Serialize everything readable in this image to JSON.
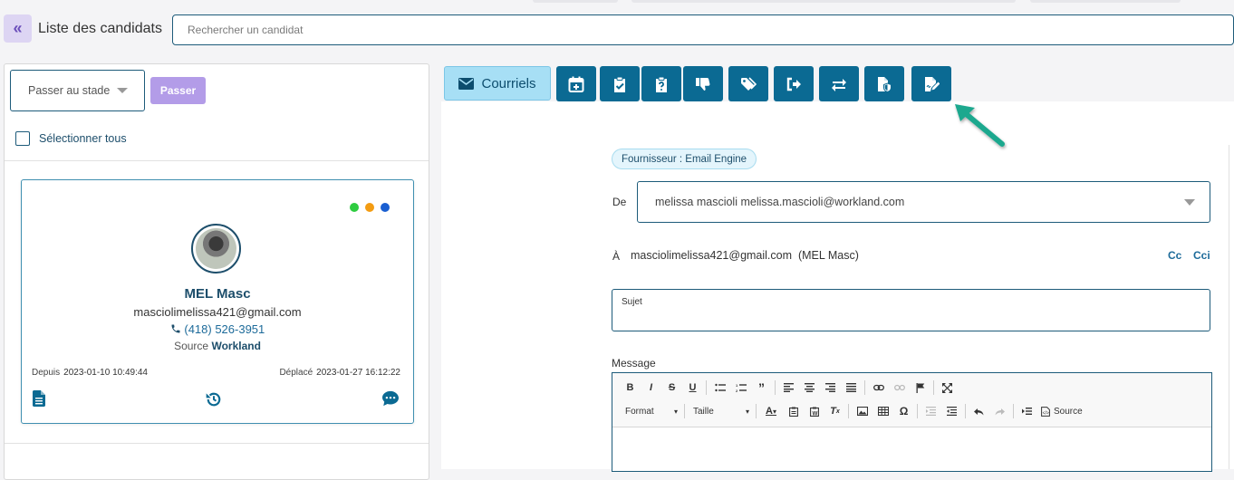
{
  "header": {
    "collapse_icon": "double-chevron-left-icon",
    "title": "Liste des candidats",
    "search_placeholder": "Rechercher un candidat"
  },
  "left_panel": {
    "stage_select": "Passer au stade",
    "pass_button": "Passer",
    "select_all": "Sélectionner tous",
    "card": {
      "status_dots": [
        "#2ecc40",
        "#f39c12",
        "#1a5fd1"
      ],
      "name": "MEL Masc",
      "email": "masciolimelissa421@gmail.com",
      "phone": "(418) 526-3951",
      "source_label": "Source",
      "source_value": "Workland",
      "since_label": "Depuis",
      "since_value": "2023-01-10 10:49:44",
      "moved_label": "Déplacé",
      "moved_value": "2023-01-27 16:12:22",
      "icons": [
        "document-icon",
        "history-icon",
        "chat-icon"
      ]
    }
  },
  "toolbar": {
    "mail_label": "Courriels",
    "buttons": [
      "calendar-add-icon",
      "clipboard-check-icon",
      "clipboard-question-icon",
      "thumbs-down-icon",
      "tags-icon",
      "sign-out-icon",
      "exchange-icon",
      "file-shield-icon",
      "signature-icon"
    ]
  },
  "email": {
    "provider": "Fournisseur : Email Engine",
    "from_label": "De",
    "from_value": "melissa mascioli melissa.mascioli@workland.com",
    "to_label": "À",
    "to_value": "masciolimelissa421@gmail.com  (MEL Masc)",
    "cc": "Cc",
    "bcc": "Cci",
    "subject_label": "Sujet",
    "message_label": "Message",
    "editor": {
      "format_label": "Format",
      "size_label": "Taille",
      "source_label": "Source"
    }
  },
  "colors": {
    "accent": "#0b6a93",
    "navy": "#1d4e6b",
    "pass_button": "#b39ce8",
    "arrow": "#1aa88e"
  }
}
